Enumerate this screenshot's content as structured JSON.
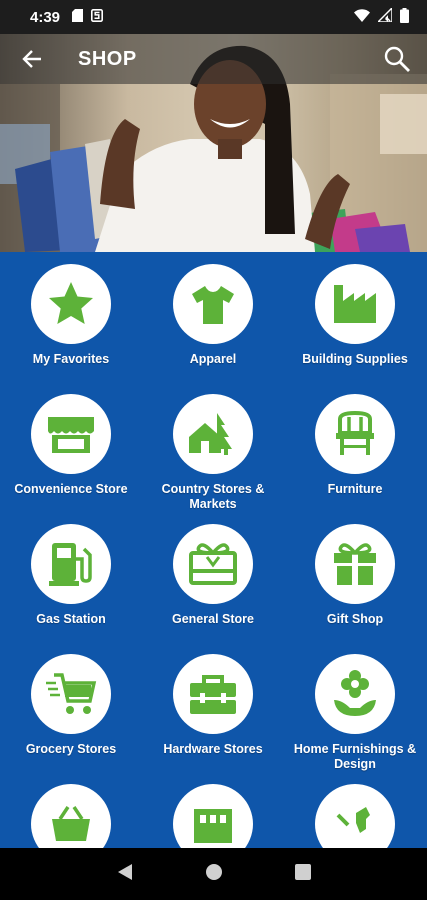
{
  "status_bar": {
    "time": "4:39",
    "icons": [
      "sd-card-icon",
      "s-icon",
      "wifi-icon",
      "signal-icon",
      "battery-icon"
    ]
  },
  "app_bar": {
    "title": "SHOP",
    "back_icon": "arrow-left-icon",
    "search_icon": "search-icon"
  },
  "colors": {
    "background_blue": "#0f56aa",
    "icon_green": "#5db239",
    "circle_white": "#ffffff"
  },
  "categories": [
    {
      "label": "My Favorites",
      "icon": "star-icon"
    },
    {
      "label": "Apparel",
      "icon": "tshirt-icon"
    },
    {
      "label": "Building Supplies",
      "icon": "factory-icon"
    },
    {
      "label": "Convenience Store",
      "icon": "storefront-icon"
    },
    {
      "label": "Country Stores & Markets",
      "icon": "house-tree-icon"
    },
    {
      "label": "Furniture",
      "icon": "chair-icon"
    },
    {
      "label": "Gas Station",
      "icon": "gas-pump-icon"
    },
    {
      "label": "General Store",
      "icon": "gift-card-icon"
    },
    {
      "label": "Gift Shop",
      "icon": "gift-icon"
    },
    {
      "label": "Grocery Stores",
      "icon": "shopping-cart-icon"
    },
    {
      "label": "Hardware Stores",
      "icon": "toolbox-icon"
    },
    {
      "label": "Home Furnishings & Design",
      "icon": "flower-pot-icon"
    },
    {
      "label": "",
      "icon": "basket-icon"
    },
    {
      "label": "",
      "icon": "building-icon"
    },
    {
      "label": "",
      "icon": "pet-icon"
    }
  ],
  "nav_bar": {
    "back": "nav-back-icon",
    "home": "nav-home-icon",
    "recents": "nav-recents-icon"
  }
}
